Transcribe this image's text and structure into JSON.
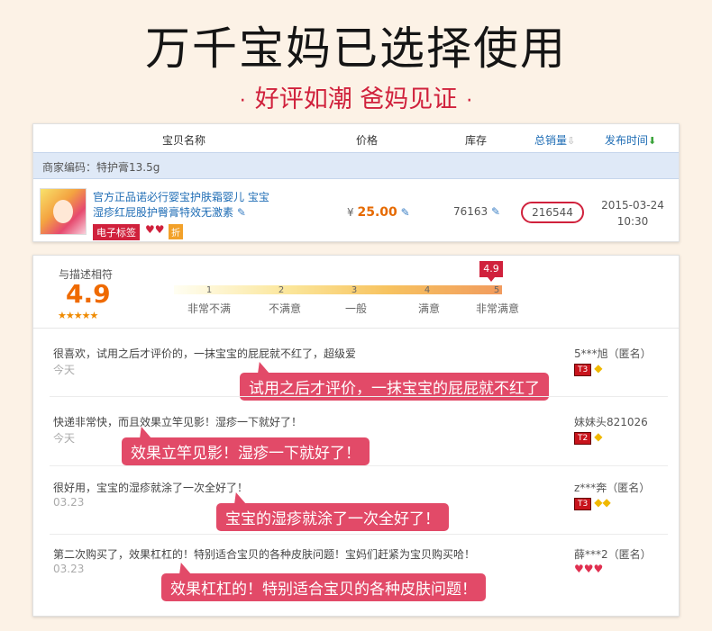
{
  "header": {
    "title": "万千宝妈已选择使用",
    "subtitle": "好评如潮  爸妈见证",
    "dot": "·"
  },
  "table": {
    "columns": {
      "name": "宝贝名称",
      "price": "价格",
      "stock": "库存",
      "sales": "总销量",
      "date": "发布时间"
    },
    "merchant_code": "商家编码：特护膏13.5g",
    "product": {
      "title": "官方正品诺必行婴宝护肤霜婴儿 宝宝湿疹红屁股护臀膏特效无激素",
      "tag_label": "电子标签",
      "tag_discount": "折",
      "price_symbol": "¥",
      "price": "25.00",
      "stock": "76163",
      "sales": "216544",
      "date": "2015-03-24",
      "time": "10:30"
    }
  },
  "rating": {
    "label": "与描述相符",
    "score": "4.9",
    "stars": "★★★★★",
    "flag": "4.9",
    "scale": [
      {
        "num": "1",
        "label": "非常不满"
      },
      {
        "num": "2",
        "label": "不满意"
      },
      {
        "num": "3",
        "label": "一般"
      },
      {
        "num": "4",
        "label": "满意"
      },
      {
        "num": "5",
        "label": "非常满意"
      }
    ]
  },
  "reviews": [
    {
      "text": "很喜欢，试用之后才评价的，一抹宝宝的屁屁就不红了，超级爱",
      "date": "今天",
      "user": "5***旭（匿名）",
      "level": "T3",
      "badges": "◆",
      "bubble": "试用之后才评价，一抹宝宝的屁屁就不红了"
    },
    {
      "text": "快递非常快，而且效果立竿见影！湿疹一下就好了！",
      "date": "今天",
      "user": "妹妹头821026",
      "level": "T2",
      "badges": "◆",
      "bubble": "效果立竿见影！湿疹一下就好了！"
    },
    {
      "text": "很好用，宝宝的湿疹就涂了一次全好了！",
      "date": "03.23",
      "user": "z***奔（匿名）",
      "level": "T3",
      "badges": "◆◆",
      "bubble": "宝宝的湿疹就涂了一次全好了！"
    },
    {
      "text": "第二次购买了，效果杠杠的！特别适合宝贝的各种皮肤问题！宝妈们赶紧为宝贝购买哈！",
      "date": "03.23",
      "user": "薛***2（匿名）",
      "level": "",
      "badges": "♥♥♥",
      "bubble": "效果杠杠的！特别适合宝贝的各种皮肤问题！"
    }
  ]
}
